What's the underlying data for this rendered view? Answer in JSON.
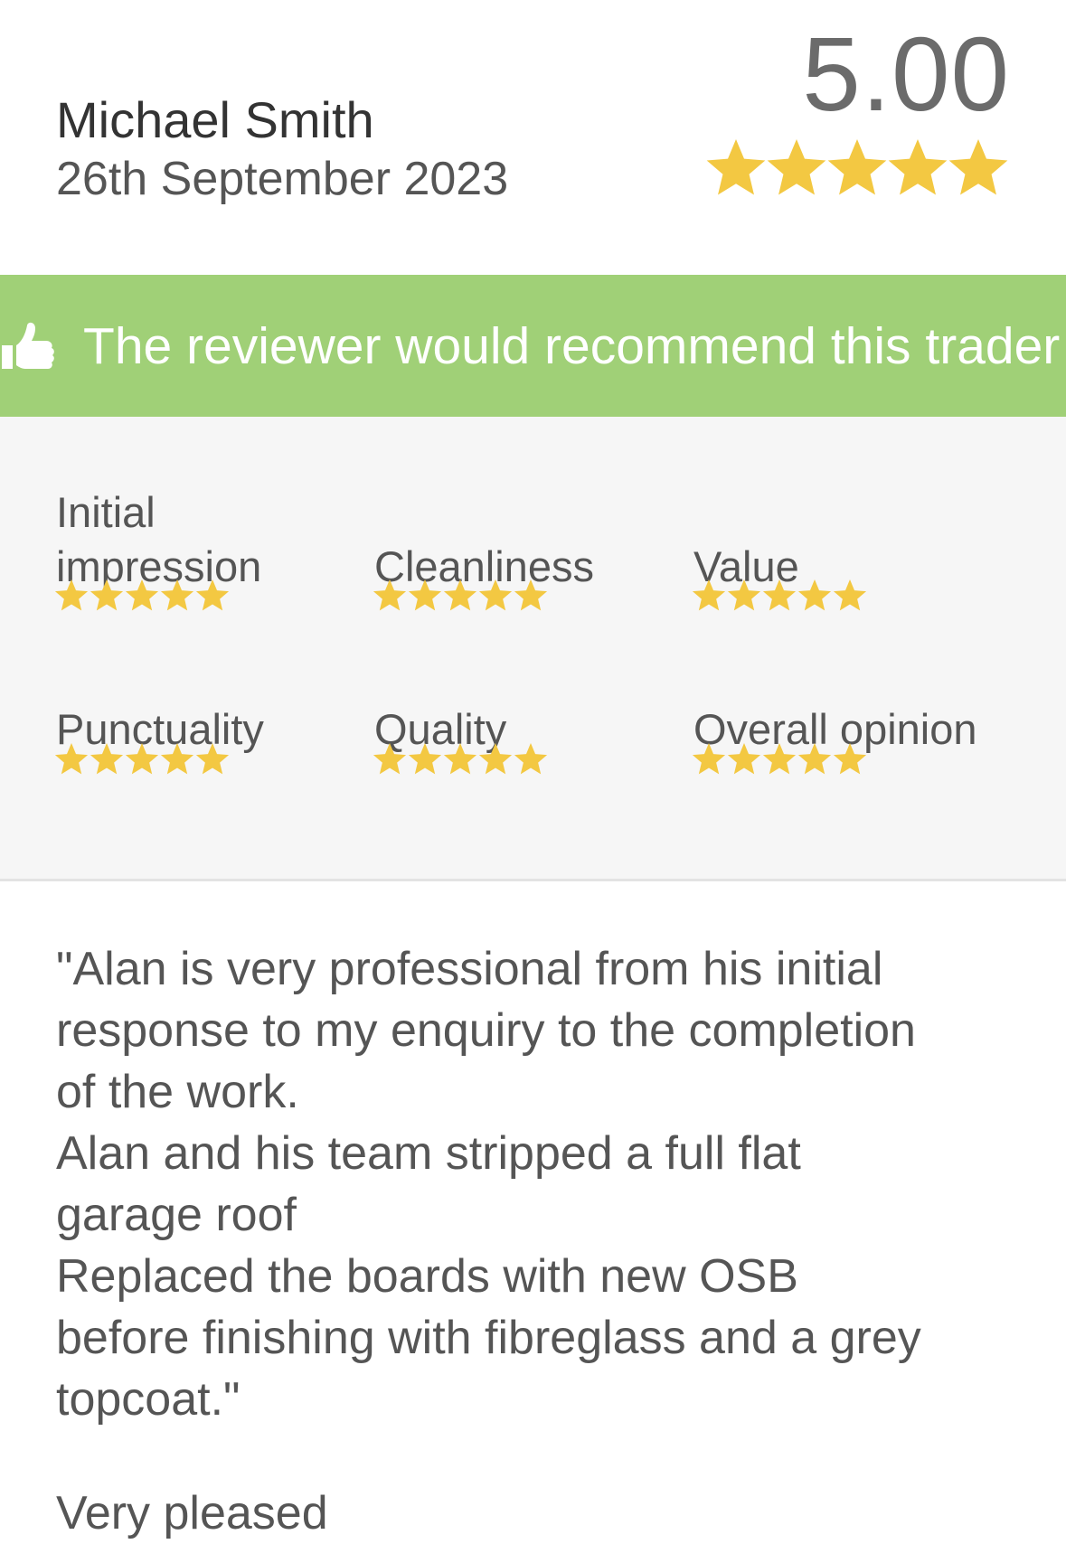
{
  "review": {
    "reviewer_name": "Michael Smith",
    "date": "26th September 2023",
    "overall_score": "5.00",
    "overall_stars": 5,
    "recommendation": "The reviewer would recommend this trader",
    "ratings": [
      {
        "label": "Initial impression",
        "stars": 5
      },
      {
        "label": "Cleanliness",
        "stars": 5
      },
      {
        "label": "Value",
        "stars": 5
      },
      {
        "label": "Punctuality",
        "stars": 5
      },
      {
        "label": "Quality",
        "stars": 5
      },
      {
        "label": "Overall opinion",
        "stars": 5
      }
    ],
    "text": "\"Alan is very professional from his initial\nresponse to my enquiry to the completion\nof the work.\nAlan and his team stripped a full flat\ngarage roof\nReplaced the boards with new OSB\nbefore finishing with fibreglass and a grey\ntopcoat.\""
  },
  "colors": {
    "star": "#f3c842",
    "recommend_bar": "#a0d077",
    "ratings_bg": "#f6f6f6"
  },
  "icons": {
    "recommend": "thumbs-up-icon",
    "rating": "star-icon"
  }
}
